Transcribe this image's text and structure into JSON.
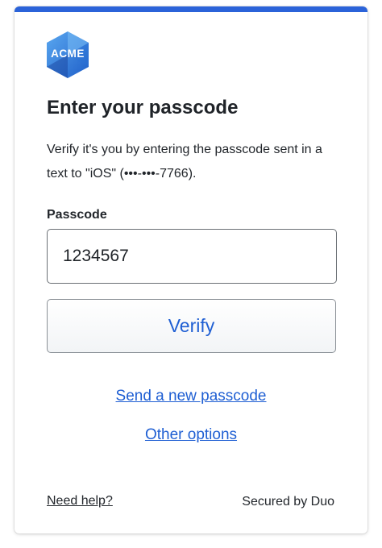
{
  "brand": {
    "logo_text": "ACME",
    "accent_color": "#2b63d9",
    "link_color": "#1f5fd3",
    "logo_icon": "hexagon-logo-icon"
  },
  "prompt": {
    "title": "Enter your passcode",
    "description": "Verify it's you by entering the passcode sent in a text to \"iOS\" (•••-•••-7766)."
  },
  "passcode_field": {
    "label": "Passcode",
    "value": "1234567"
  },
  "actions": {
    "verify_label": "Verify",
    "send_new_passcode_label": "Send a new passcode",
    "other_options_label": "Other options"
  },
  "footer": {
    "help_label": "Need help?",
    "secured_by": "Secured by Duo"
  }
}
